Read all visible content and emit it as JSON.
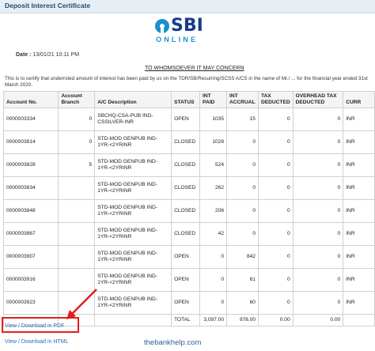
{
  "header": {
    "title": "Deposit Interest Certificate"
  },
  "logo": {
    "main": "SBI",
    "sub": "ONLINE"
  },
  "date": {
    "label": "Date :",
    "value": "13/01/21 10:11 PM"
  },
  "heading": "TO WHOMSOEVER IT MAY CONCERN",
  "paragraph": "This is to certify that underroted amount of interest has been paid by us on the TDR/SB/Recurring/SCSS A/CS in the name of Mr./ ... for the financial year ended 31st March 2020.",
  "table": {
    "columns": [
      "Account No.",
      "Account Branch",
      "A/C Description",
      "STATUS",
      "INT PAID",
      "INT ACCRUAL",
      "TAX DEDUCTED",
      "OVERHEAD TAX DEDUCTED",
      "CURR"
    ],
    "rows": [
      [
        "0000003334",
        "0",
        "SBCHQ-CSA-PUB IND-CSSILVER-INR",
        "OPEN",
        "1035",
        "15",
        "0",
        "0",
        "INR"
      ],
      [
        "0000003814",
        "0",
        "STD-MOD GENPUB IND-1YR-<2YRINR",
        "CLOSED",
        "1028",
        "0",
        "0",
        "0",
        "INR"
      ],
      [
        "0000003828",
        "5",
        "STD-MOD GENPUB IND-1YR-<2YRINR",
        "CLOSED",
        "524",
        "0",
        "0",
        "0",
        "INR"
      ],
      [
        "0000003834",
        "",
        "STD-MOD GENPUB IND-1YR-<2YRINR",
        "CLOSED",
        "262",
        "0",
        "0",
        "0",
        "INR"
      ],
      [
        "0000003848",
        "",
        "STD-MOD GENPUB IND-1YR-<2YRINR",
        "CLOSED",
        "206",
        "0",
        "0",
        "0",
        "INR"
      ],
      [
        "0000003867",
        "",
        "STD-MOD GENPUB IND-1YR-<2YRINR",
        "CLOSED",
        "42",
        "0",
        "0",
        "0",
        "INR"
      ],
      [
        "0000003907",
        "",
        "STD-MOD GENPUB IND-1YR-<2YRINR",
        "OPEN",
        "0",
        "842",
        "0",
        "0",
        "INR"
      ],
      [
        "0000003916",
        "",
        "STD-MOD GENPUB IND-1YR-<2YRINR",
        "OPEN",
        "0",
        "61",
        "0",
        "0",
        "INR"
      ],
      [
        "0000003923",
        "",
        "STD-MOD GENPUB IND-1YR-<2YRINR",
        "OPEN",
        "0",
        "60",
        "0",
        "0",
        "INR"
      ]
    ],
    "total": {
      "label": "TOTAL",
      "int_paid": "3,097.00",
      "int_accrual": "978.00",
      "tax": "0.00",
      "overhead": "0.00"
    }
  },
  "links": {
    "pdf": "View / Download in PDF",
    "html": "View / Download in HTML"
  },
  "watermark": "thebankhelp.com",
  "colors": {
    "header_bg": "#e6eef6",
    "link": "#2b6cb0",
    "highlight": "#e21d1d",
    "logo_blue": "#1b8fd1"
  }
}
